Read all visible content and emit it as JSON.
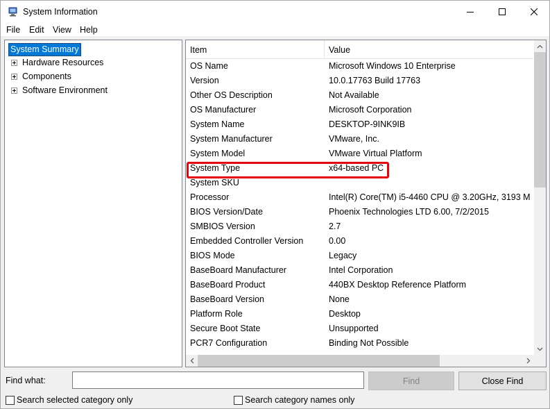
{
  "window": {
    "title": "System Information",
    "controls": {
      "minimize": "minimize",
      "maximize": "maximize",
      "close": "close"
    }
  },
  "menu": [
    "File",
    "Edit",
    "View",
    "Help"
  ],
  "tree": {
    "root": "System Summary",
    "children": [
      "Hardware Resources",
      "Components",
      "Software Environment"
    ]
  },
  "list": {
    "columns": {
      "item": "Item",
      "value": "Value"
    },
    "rows": [
      {
        "item": "OS Name",
        "value": "Microsoft Windows 10 Enterprise"
      },
      {
        "item": "Version",
        "value": "10.0.17763 Build 17763"
      },
      {
        "item": "Other OS Description",
        "value": "Not Available"
      },
      {
        "item": "OS Manufacturer",
        "value": "Microsoft Corporation"
      },
      {
        "item": "System Name",
        "value": "DESKTOP-9INK9IB"
      },
      {
        "item": "System Manufacturer",
        "value": "VMware, Inc."
      },
      {
        "item": "System Model",
        "value": "VMware Virtual Platform"
      },
      {
        "item": "System Type",
        "value": "x64-based PC"
      },
      {
        "item": "System SKU",
        "value": ""
      },
      {
        "item": "Processor",
        "value": "Intel(R) Core(TM) i5-4460  CPU @ 3.20GHz, 3193 M"
      },
      {
        "item": "BIOS Version/Date",
        "value": "Phoenix Technologies LTD 6.00, 7/2/2015"
      },
      {
        "item": "SMBIOS Version",
        "value": "2.7"
      },
      {
        "item": "Embedded Controller Version",
        "value": "0.00"
      },
      {
        "item": "BIOS Mode",
        "value": "Legacy"
      },
      {
        "item": "BaseBoard Manufacturer",
        "value": "Intel Corporation"
      },
      {
        "item": "BaseBoard Product",
        "value": "440BX Desktop Reference Platform"
      },
      {
        "item": "BaseBoard Version",
        "value": "None"
      },
      {
        "item": "Platform Role",
        "value": "Desktop"
      },
      {
        "item": "Secure Boot State",
        "value": "Unsupported"
      },
      {
        "item": "PCR7 Configuration",
        "value": "Binding Not Possible"
      }
    ],
    "highlighted_item": "System Type",
    "highlight_color": "#e8000b",
    "selection_color": "#0078d7"
  },
  "find": {
    "label": "Find what:",
    "value": "",
    "find_button": "Find",
    "close_button": "Close Find",
    "option_selected_category": "Search selected category only",
    "option_category_names": "Search category names only"
  }
}
